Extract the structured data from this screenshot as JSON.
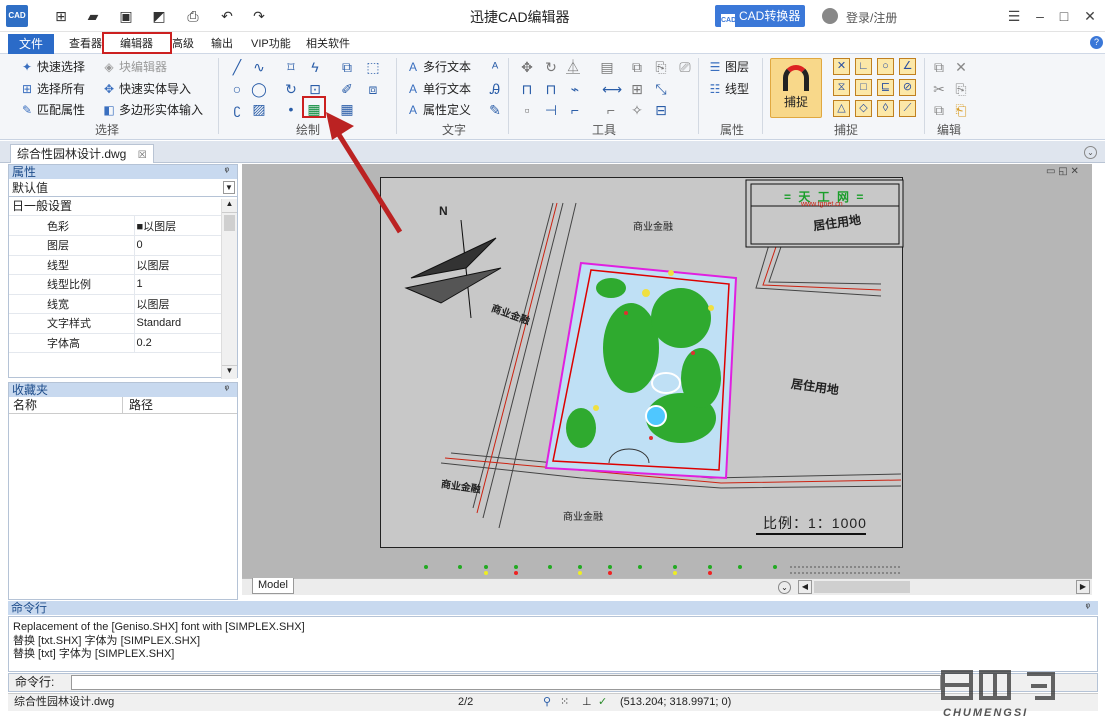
{
  "app": {
    "icon_text": "CAD",
    "title": "迅捷CAD编辑器",
    "convert_button": "CAD转换器",
    "login": "登录/注册"
  },
  "tabs": {
    "file": "文件",
    "viewer": "查看器",
    "editor": "编辑器",
    "advanced": "高级",
    "output": "输出",
    "vip": "VIP功能",
    "related": "相关软件"
  },
  "ribbon": {
    "select": {
      "quick_select": "快速选择",
      "block_editor": "块编辑器",
      "select_all": "选择所有",
      "quick_import": "快速实体导入",
      "match_props": "匹配属性",
      "poly_input": "多边形实体输入",
      "label": "选择"
    },
    "draw": {
      "label": "绘制"
    },
    "text": {
      "mtext": "多行文本",
      "stext": "单行文本",
      "attdef": "属性定义",
      "label": "文字"
    },
    "tools": {
      "label": "工具"
    },
    "props": {
      "layer": "图层",
      "linetype": "线型",
      "label": "属性"
    },
    "snap": {
      "big": "捕捉",
      "label": "捕捉"
    },
    "edit": {
      "label": "编辑"
    }
  },
  "document": {
    "tab": "综合性园林设计.dwg"
  },
  "properties": {
    "title": "属性",
    "selected": "默认值",
    "section": "日一般设置",
    "rows": [
      {
        "k": "色彩",
        "v": "■以图层"
      },
      {
        "k": "图层",
        "v": "0"
      },
      {
        "k": "线型",
        "v": "以图层"
      },
      {
        "k": "线型比例",
        "v": "1"
      },
      {
        "k": "线宽",
        "v": "以图层"
      },
      {
        "k": "文字样式",
        "v": "Standard"
      },
      {
        "k": "字体高",
        "v": "0.2"
      }
    ]
  },
  "favorites": {
    "title": "收藏夹",
    "col_name": "名称",
    "col_path": "路径"
  },
  "drawing": {
    "north": "N",
    "site_title": "= 天 工 网 =",
    "site_url": "www.tgnet.cn",
    "box_label": "居住用地",
    "label_top": "商业金融",
    "label_left": "商业金融",
    "label_right": "居住用地",
    "label_bottom_left": "商业金融",
    "label_bottom": "商业金融",
    "scale": "比例：1：1000",
    "model_tab": "Model"
  },
  "command": {
    "title": "命令行",
    "log": [
      "Replacement of the [Geniso.SHX] font with [SIMPLEX.SHX]",
      "替换 [txt.SHX] 字体为 [SIMPLEX.SHX]",
      "替换 [txt] 字体为 [SIMPLEX.SHX]"
    ],
    "prompt": "命令行:"
  },
  "status": {
    "file": "综合性园林设计.dwg",
    "page": "2/2",
    "coords": "(513.204; 318.9971; 0)"
  },
  "watermark": {
    "text": "CHUMENGSI"
  },
  "colors": {
    "accent": "#2b6bc8",
    "highlight": "#cc2020",
    "canvas": "#b6b6b6"
  }
}
